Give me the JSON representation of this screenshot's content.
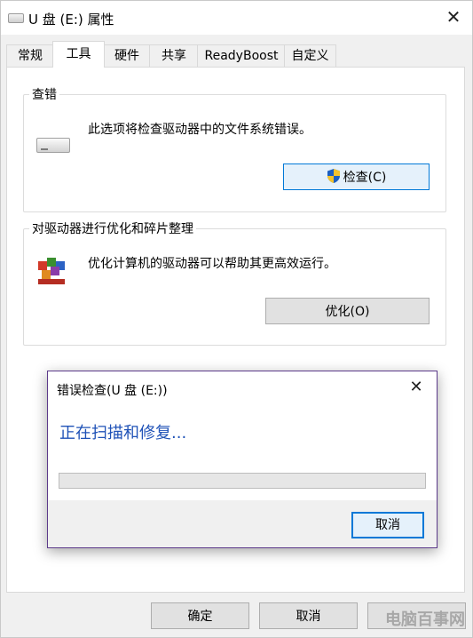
{
  "window": {
    "title": "U 盘 (E:) 属性",
    "close_glyph": "✕"
  },
  "tabs": [
    {
      "label": "常规"
    },
    {
      "label": "工具"
    },
    {
      "label": "硬件"
    },
    {
      "label": "共享"
    },
    {
      "label": "ReadyBoost"
    },
    {
      "label": "自定义"
    }
  ],
  "active_tab": "工具",
  "error_check": {
    "group_title": "查错",
    "description": "此选项将检查驱动器中的文件系统错误。",
    "button_label": "检查(C)"
  },
  "optimize": {
    "group_title": "对驱动器进行优化和碎片整理",
    "description": "优化计算机的驱动器可以帮助其更高效运行。",
    "button_label": "优化(O)"
  },
  "dialog": {
    "title": "错误检查(U 盘 (E:))",
    "close_glyph": "✕",
    "status": "正在扫描和修复...",
    "progress": 0,
    "cancel_label": "取消"
  },
  "footer": {
    "ok_label": "确定",
    "cancel_label": "取消"
  },
  "watermark": "电脑百事网",
  "colors": {
    "status_text": "#1f52b7",
    "focus_border": "#0078d7",
    "dialog_border": "#5c3a8a"
  }
}
